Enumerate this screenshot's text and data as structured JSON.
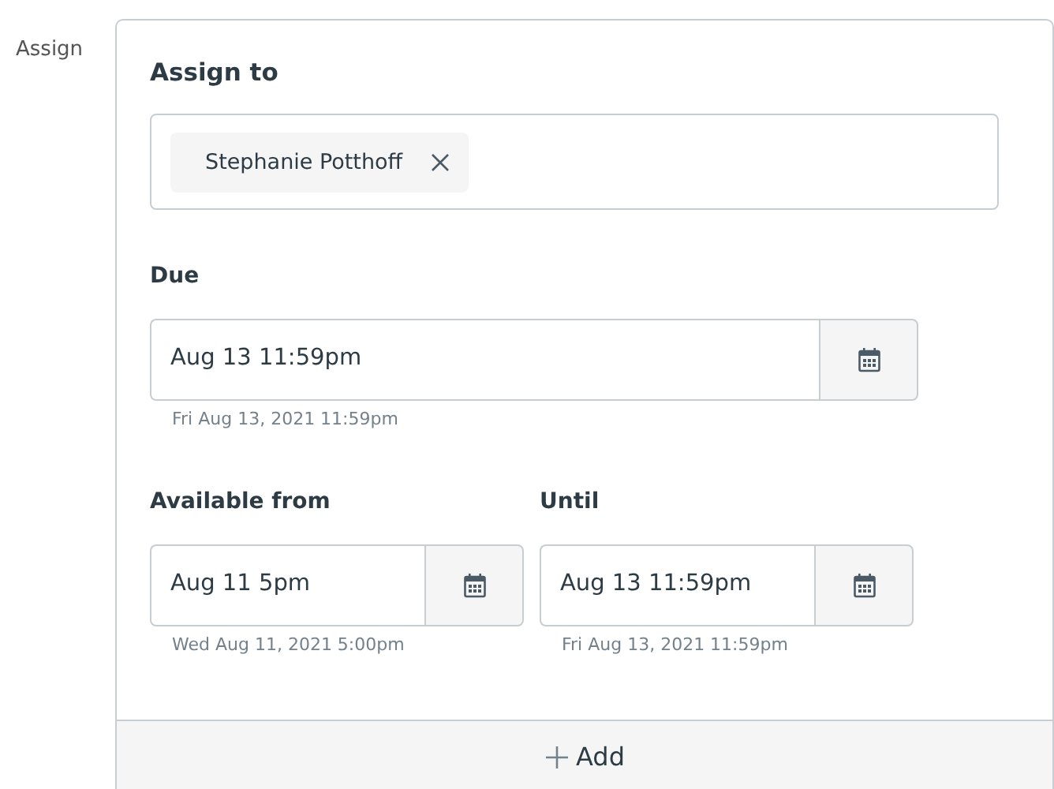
{
  "section_label": "Assign",
  "assign_to": {
    "label": "Assign to",
    "tokens": [
      {
        "label": "Stephanie Potthoff"
      }
    ]
  },
  "due": {
    "label": "Due",
    "value": "Aug 13 11:59pm",
    "hint": "Fri Aug 13, 2021 11:59pm"
  },
  "availability": [
    {
      "label": "Available from",
      "value": "Aug 11 5pm",
      "hint": "Wed Aug 11, 2021 5:00pm"
    },
    {
      "label": "Until",
      "value": "Aug 13 11:59pm",
      "hint": "Fri Aug 13, 2021 11:59pm"
    }
  ],
  "add_button": "Add"
}
